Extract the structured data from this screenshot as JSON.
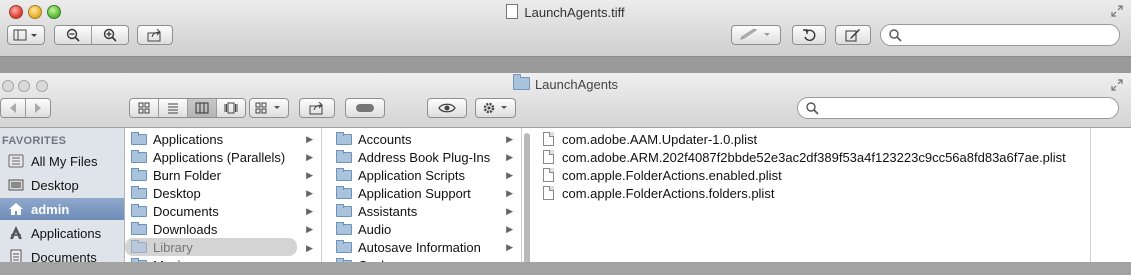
{
  "outer": {
    "title": "LaunchAgents.tiff"
  },
  "finder": {
    "title": "LaunchAgents",
    "sidebar": {
      "heading": "FAVORITES",
      "items": [
        {
          "label": "All My Files",
          "icon": "all-files-icon"
        },
        {
          "label": "Desktop",
          "icon": "desktop-icon"
        },
        {
          "label": "admin",
          "icon": "home-icon"
        },
        {
          "label": "Applications",
          "icon": "applications-icon"
        },
        {
          "label": "Documents",
          "icon": "documents-icon"
        }
      ]
    },
    "col1": [
      "Applications",
      "Applications (Parallels)",
      "Burn Folder",
      "Desktop",
      "Documents",
      "Downloads",
      "Library",
      "Movies"
    ],
    "col2": [
      "Accounts",
      "Address Book Plug-Ins",
      "Application Scripts",
      "Application Support",
      "Assistants",
      "Audio",
      "Autosave Information",
      "Caches"
    ],
    "col3": [
      "com.adobe.AAM.Updater-1.0.plist",
      "com.adobe.ARM.202f4087f2bbde52e3ac2df389f53a4f123223c9cc56a8fd83a6f7ae.plist",
      "com.apple.FolderActions.enabled.plist",
      "com.apple.FolderActions.folders.plist"
    ]
  },
  "colors": {
    "sidebar_bg": "#dfe4ea",
    "sidebar_selected": "#7a95bf",
    "folder_blue": "#a9c3dd"
  }
}
